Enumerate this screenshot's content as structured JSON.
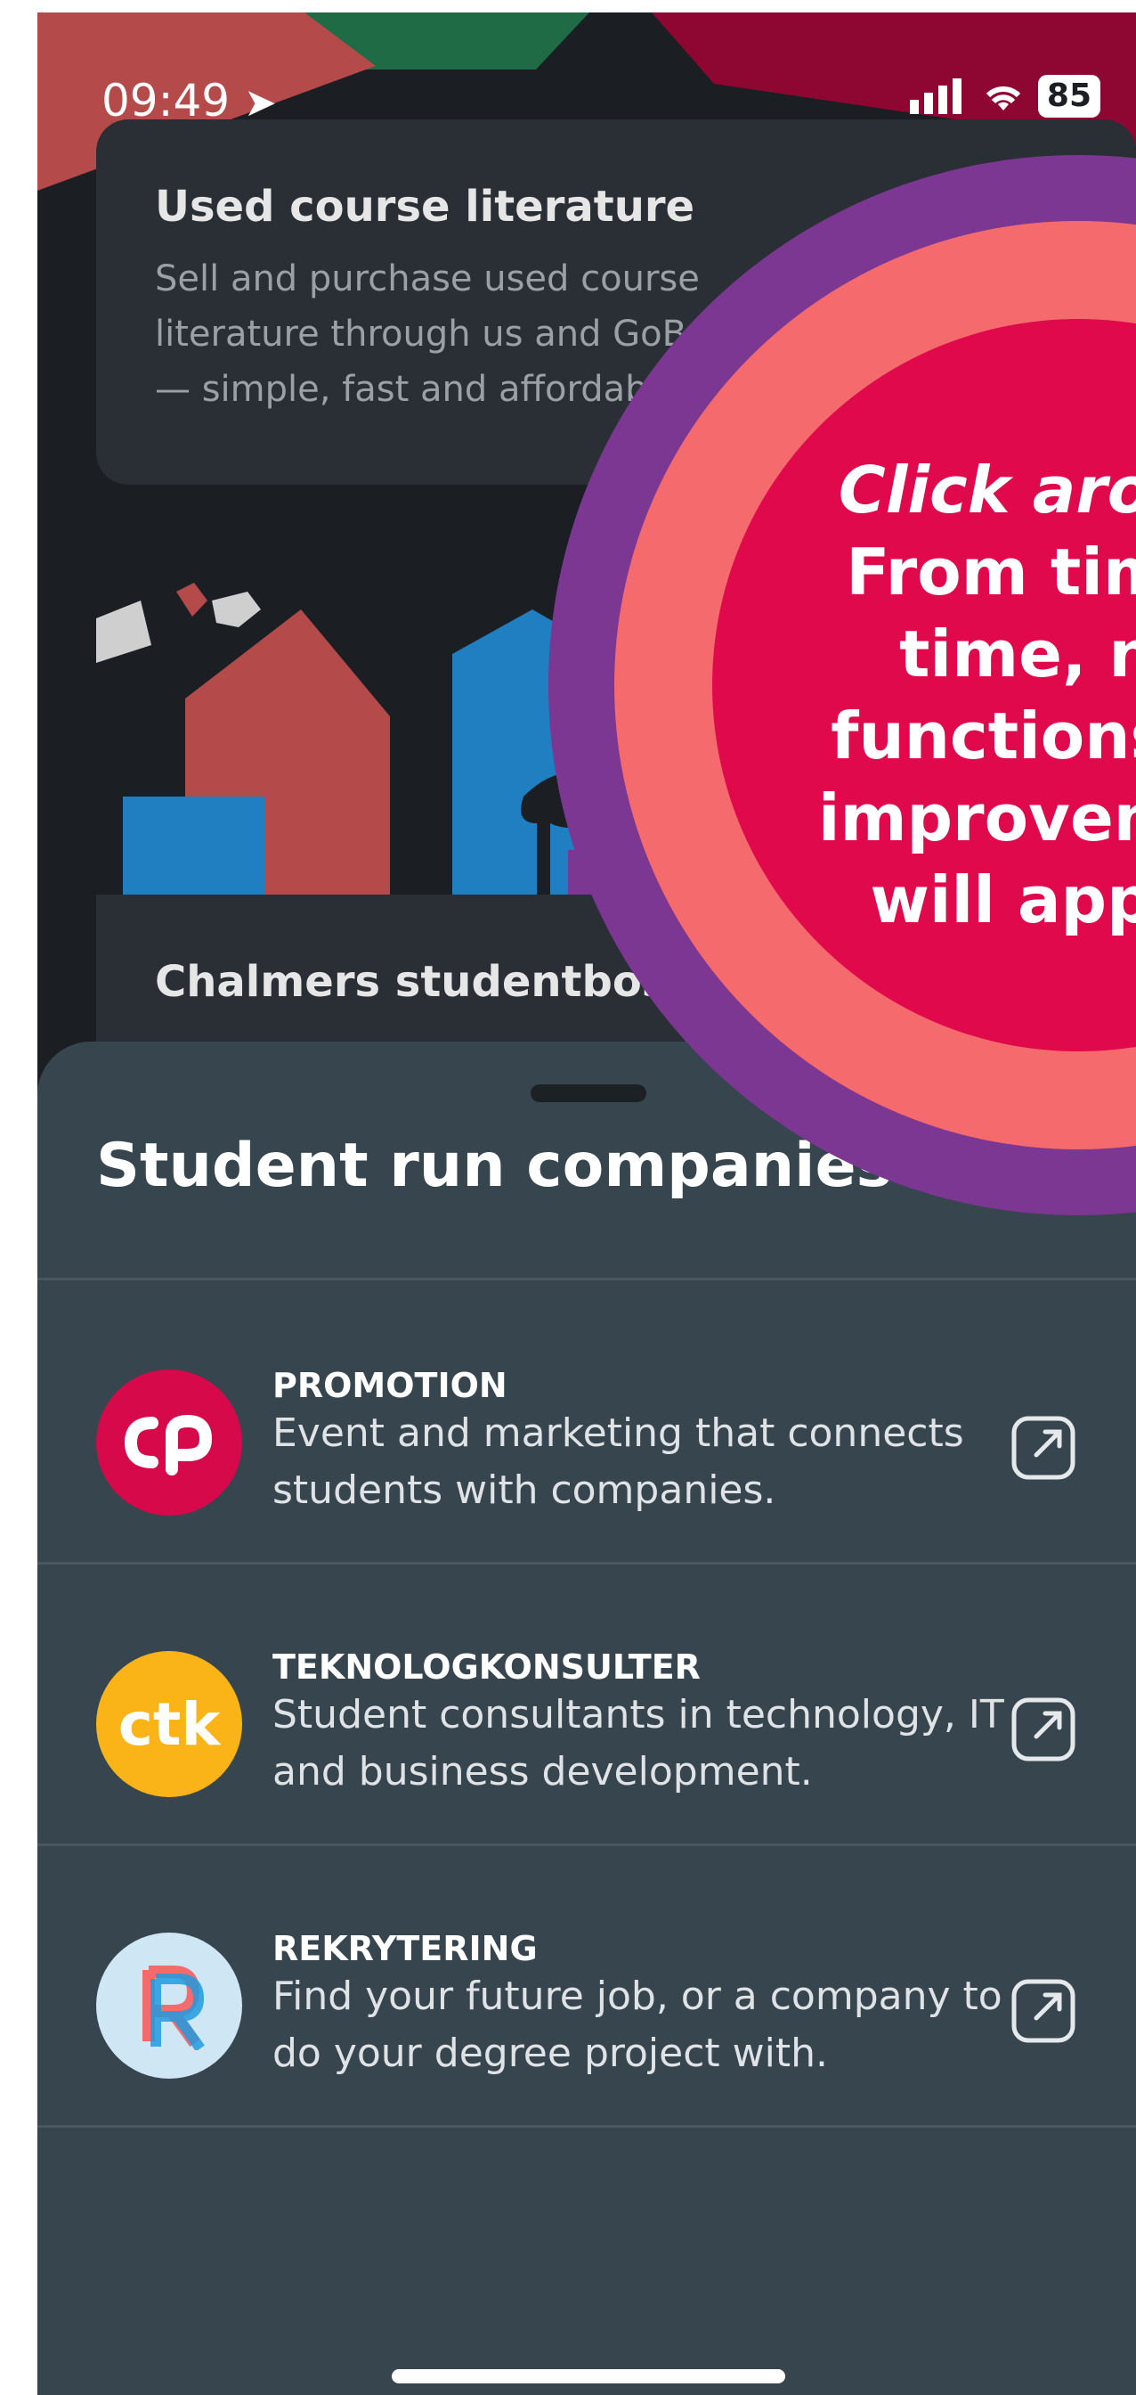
{
  "status_bar": {
    "time": "09:49",
    "battery": "85"
  },
  "background": {
    "card1": {
      "title": "Used course literature",
      "description": "Sell and purchase used course literature through us and GoBookGo — simple, fast and affordable."
    },
    "card2": {
      "title": "Chalmers studentbostäder"
    }
  },
  "sheet": {
    "title": "Student run companies",
    "items": [
      {
        "title": "PROMOTION",
        "description": "Event and marketing that connects students with companies.",
        "logo_text": "cp",
        "logo_color": "#d6094a"
      },
      {
        "title": "TEKNOLOGKONSULTER",
        "description": "Student consultants in technology, IT and business development.",
        "logo_text": "ctk",
        "logo_color": "#fbb417"
      },
      {
        "title": "REKRYTERING",
        "description": "Find your future job, or a company to do your degree project with.",
        "logo_text": "R",
        "logo_color": "#cfe6f5"
      }
    ]
  },
  "tooltip": {
    "heading": "Click around!",
    "body": "From time to time, new functions and improvements will appear."
  },
  "colors": {
    "sheet_bg": "#37454e",
    "ring_outer": "#7b3792",
    "ring_mid": "#f46a6d",
    "ring_inner": "#e0094b"
  }
}
